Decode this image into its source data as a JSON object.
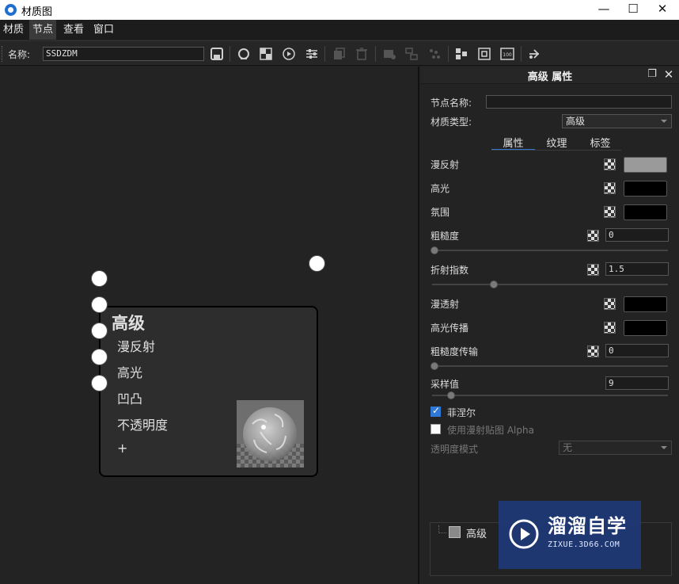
{
  "window": {
    "title": "材质图",
    "minimize": "—",
    "maximize": "☐",
    "close": "✕"
  },
  "menu": [
    "材质",
    "节点",
    "查看",
    "窗口"
  ],
  "toolbar": {
    "name_label": "名称:",
    "name_value": "SSDZDM",
    "buttons": [
      "save-icon",
      "loop-icon",
      "checker-icon",
      "play-circle-icon",
      "sliders-icon",
      "copy-icon",
      "trash-icon",
      "node-disabled-icon",
      "node-group-icon",
      "node-ungroup-icon",
      "layout-icon",
      "fit-view-icon",
      "zoom-100-icon",
      "share-icon"
    ],
    "zoom_label": "100"
  },
  "node": {
    "title": "高级",
    "ports": [
      "漫反射",
      "高光",
      "凹凸",
      "不透明度",
      "+"
    ],
    "preview": "material-sphere-preview"
  },
  "panel": {
    "title": "高级  属性",
    "node_name_label": "节点名称:",
    "node_name_value": "",
    "material_type_label": "材质类型:",
    "material_type_value": "高级",
    "tabs": [
      "属性",
      "纹理",
      "标签"
    ],
    "active_tab": "属性",
    "props": {
      "diffuse": {
        "label": "漫反射",
        "color": "#9a9a9a"
      },
      "specular": {
        "label": "高光",
        "color": "#000000"
      },
      "ambient": {
        "label": "氛围",
        "color": "#000000"
      },
      "roughness": {
        "label": "粗糙度",
        "value": "0",
        "slider": 0.0
      },
      "ior": {
        "label": "折射指数",
        "value": "1.5",
        "slider": 0.25
      },
      "transmission": {
        "label": "漫透射",
        "color": "#000000"
      },
      "specular_transmission": {
        "label": "高光传播",
        "color": "#000000"
      },
      "roughness_transmission": {
        "label": "粗糙度传输",
        "value": "0",
        "slider": 0.0
      },
      "samples": {
        "label": "采样值",
        "value": "9",
        "slider": 0.07
      },
      "fresnel": {
        "label": "菲涅尔",
        "checked": true
      },
      "diffuse_alpha": {
        "label": "使用漫射贴图 Alpha",
        "checked": false
      },
      "opacity_mode": {
        "label": "透明度模式",
        "value": "无"
      }
    },
    "tree_item": "高级"
  },
  "watermark": {
    "title": "溜溜自学",
    "subtitle": "ZIXUE.3D66.COM"
  }
}
